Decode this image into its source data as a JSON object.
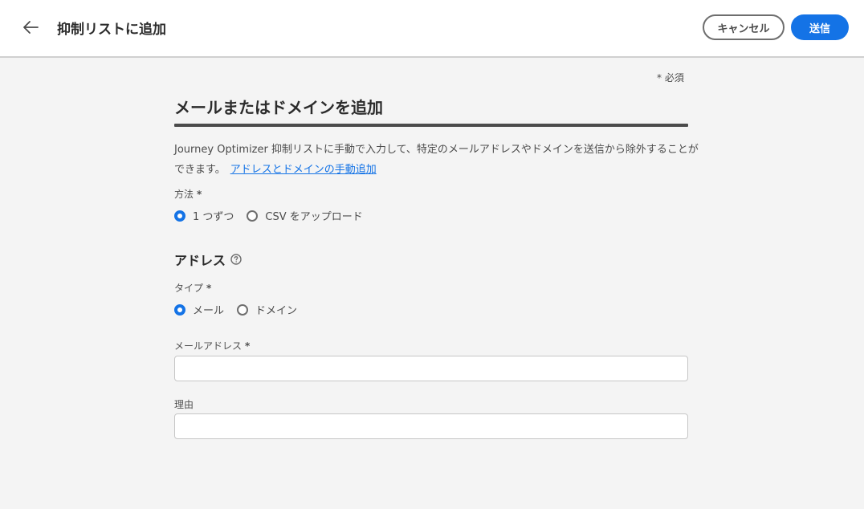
{
  "header": {
    "title": "抑制リストに追加",
    "cancel_label": "キャンセル",
    "send_label": "送信"
  },
  "form": {
    "required_note": "* 必須",
    "title": "メールまたはドメインを追加",
    "description": "Journey Optimizer 抑制リストに手動で入力して、特定のメールアドレスやドメインを送信から除外することができます。",
    "description_link": "アドレスとドメインの手動追加",
    "method": {
      "label": "方法",
      "options": [
        {
          "label": "1 つずつ",
          "checked": true
        },
        {
          "label": "CSV をアップロード",
          "checked": false
        }
      ]
    },
    "address_section": {
      "title": "アドレス"
    },
    "type": {
      "label": "タイプ",
      "options": [
        {
          "label": "メール",
          "checked": true
        },
        {
          "label": "ドメイン",
          "checked": false
        }
      ]
    },
    "email_field": {
      "label": "メールアドレス",
      "value": "",
      "placeholder": ""
    },
    "reason_field": {
      "label": "理由",
      "value": "",
      "placeholder": ""
    },
    "required_marker": "*"
  },
  "colors": {
    "accent": "#1473e6",
    "background": "#f4f4f4",
    "text": "#2c2c2c"
  }
}
